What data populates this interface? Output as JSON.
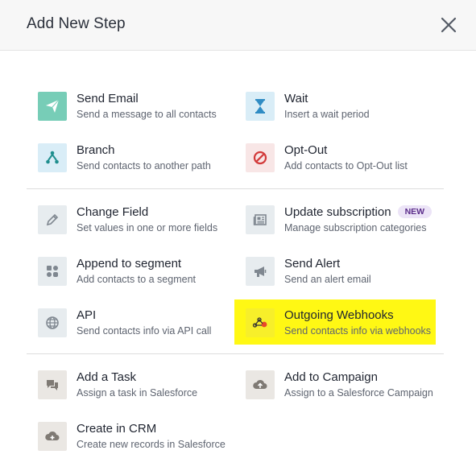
{
  "dialog": {
    "title": "Add New Step"
  },
  "colors": {
    "email_icon_bg": "#77cdb7",
    "light_blue_icon_bg": "#d9edf7",
    "gray_icon_bg": "#e7ecef",
    "salesforce_icon_bg": "#eae7e3",
    "highlight": "#fff814",
    "badge_bg": "#ece4f7",
    "badge_text": "#5b2d8a"
  },
  "items": {
    "send_email": {
      "name": "Send Email",
      "desc": "Send a message to all contacts",
      "icon": "paper-plane-icon"
    },
    "wait": {
      "name": "Wait",
      "desc": "Insert a wait period",
      "icon": "hourglass-icon"
    },
    "branch": {
      "name": "Branch",
      "desc": "Send contacts to another path",
      "icon": "branch-icon"
    },
    "opt_out": {
      "name": "Opt-Out",
      "desc": "Add contacts to Opt-Out list",
      "icon": "prohibited-icon"
    },
    "change_field": {
      "name": "Change Field",
      "desc": "Set values in one or more fields",
      "icon": "pencil-icon"
    },
    "update_subscription": {
      "name": "Update subscription",
      "badge": "NEW",
      "desc": "Manage subscription categories",
      "icon": "newspaper-icon"
    },
    "append_segment": {
      "name": "Append to segment",
      "desc": "Add contacts to a segment",
      "icon": "segment-shapes-icon"
    },
    "send_alert": {
      "name": "Send Alert",
      "desc": "Send an alert email",
      "icon": "megaphone-icon"
    },
    "api": {
      "name": "API",
      "desc": "Send contacts info via API call",
      "icon": "globe-icon"
    },
    "outgoing_webhooks": {
      "name": "Outgoing Webhooks",
      "desc": "Send contacts info via webhooks",
      "icon": "webhook-icon"
    },
    "add_task": {
      "name": "Add a Task",
      "desc": "Assign a task in Salesforce",
      "icon": "chat-bubbles-icon"
    },
    "add_campaign": {
      "name": "Add to Campaign",
      "desc": "Assign to a Salesforce Campaign",
      "icon": "cloud-upload-icon"
    },
    "create_crm": {
      "name": "Create in CRM",
      "desc": "Create new records in Salesforce",
      "icon": "cloud-plus-icon"
    }
  }
}
